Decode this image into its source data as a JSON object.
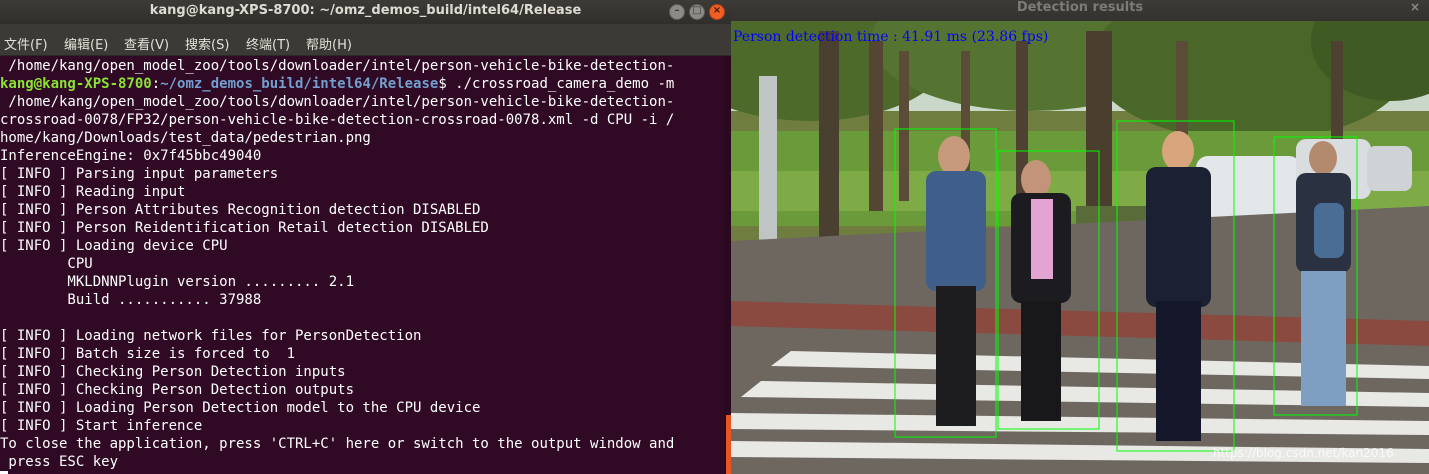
{
  "terminal": {
    "title": "kang@kang-XPS-8700: ~/omz_demos_build/intel64/Release",
    "controls": {
      "minimize": "–",
      "maximize": "□",
      "close": "×"
    },
    "menu": [
      "文件(F)",
      "编辑(E)",
      "查看(V)",
      "搜索(S)",
      "终端(T)",
      "帮助(H)"
    ],
    "lines": [
      " /home/kang/open_model_zoo/tools/downloader/intel/person-vehicle-bike-detection-",
      "",
      " /home/kang/open_model_zoo/tools/downloader/intel/person-vehicle-bike-detection-",
      "crossroad-0078/FP32/person-vehicle-bike-detection-crossroad-0078.xml -d CPU -i /",
      "home/kang/Downloads/test_data/pedestrian.png",
      "InferenceEngine: 0x7f45bbc49040",
      "[ INFO ] Parsing input parameters",
      "[ INFO ] Reading input",
      "[ INFO ] Person Attributes Recognition detection DISABLED",
      "[ INFO ] Person Reidentification Retail detection DISABLED",
      "[ INFO ] Loading device CPU",
      "        CPU",
      "        MKLDNNPlugin version ......... 2.1",
      "        Build ........... 37988",
      "",
      "[ INFO ] Loading network files for PersonDetection",
      "[ INFO ] Batch size is forced to  1",
      "[ INFO ] Checking Person Detection inputs",
      "[ INFO ] Checking Person Detection outputs",
      "[ INFO ] Loading Person Detection model to the CPU device",
      "[ INFO ] Start inference",
      "To close the application, press 'CTRL+C' here or switch to the output window and",
      " press ESC key"
    ],
    "prompt": {
      "user_host": "kang@kang-XPS-8700",
      "separator": ":",
      "path": "~/omz_demos_build/intel64/Release",
      "symbol": "$",
      "command": " ./crossroad_camera_demo -m"
    },
    "colors": {
      "background": "#300a24",
      "user": "#8ae234",
      "path": "#729fcf",
      "scroll_thumb": "#e95420"
    }
  },
  "detection_window": {
    "title": "Detection results",
    "close": "×",
    "overlay_text": "Person detection time  : 41.91 ms (23.86 fps)",
    "watermark": "https://blog.csdn.net/kan2016",
    "box_color": "#00ff00",
    "text_color": "#0000ff"
  }
}
